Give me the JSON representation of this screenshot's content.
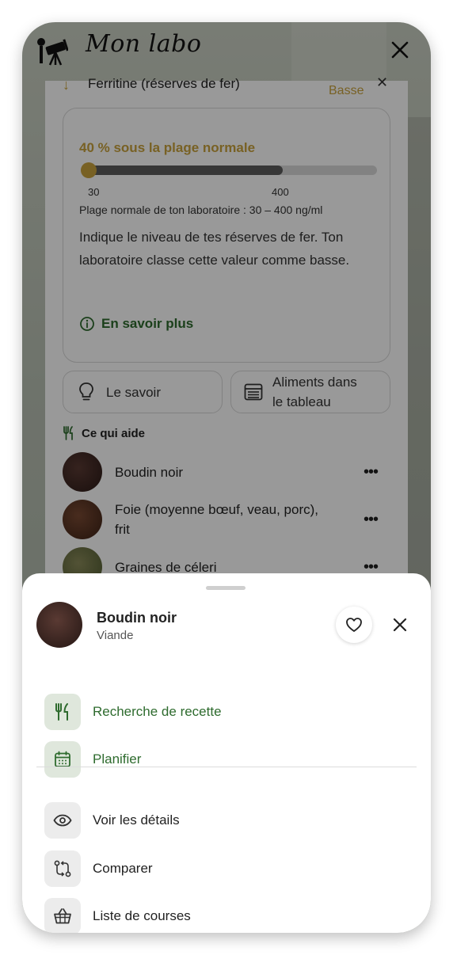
{
  "app": {
    "title": "Mon labo"
  },
  "marker": {
    "name": "Ferritine (réserves de fer)",
    "status": "Basse",
    "deviation_text": "40 % sous la plage normale",
    "range_min": "30",
    "range_max": "400",
    "value_position": 0.0,
    "normal_fill": 0.68,
    "normal_range_text": "Plage normale de ton laboratoire : 30 – 400 ng/ml",
    "description": "Indique le niveau de tes réserves de fer. Ton laboratoire classe cette valeur comme basse.",
    "learn_more": "En savoir plus"
  },
  "chips": {
    "knowledge": "Le savoir",
    "foods_table_line1": "Aliments dans",
    "foods_table_line2": "le tableau"
  },
  "helps": {
    "title": "Ce qui aide",
    "items": [
      {
        "name": "Boudin noir"
      },
      {
        "name_line1": "Foie (moyenne bœuf, veau, porc),",
        "name_line2": "frit"
      },
      {
        "name": "Graines de céleri"
      }
    ]
  },
  "sheet": {
    "title": "Boudin noir",
    "subtitle": "Viande",
    "actions": [
      {
        "label": "Recherche de recette",
        "icon": "fork-knife-icon"
      },
      {
        "label": "Planifier",
        "icon": "calendar-icon"
      },
      {
        "label": "Voir les détails",
        "icon": "eye-icon"
      },
      {
        "label": "Comparer",
        "icon": "compare-icon"
      },
      {
        "label": "Liste de courses",
        "icon": "basket-icon"
      }
    ]
  },
  "colors": {
    "accent_gold": "#c9a23d",
    "accent_green": "#2e6b2e",
    "icon_green_bg": "#dfe7dc",
    "icon_grey_bg": "#ececec"
  }
}
